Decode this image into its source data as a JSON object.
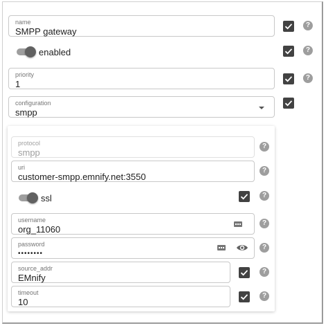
{
  "gateway": {
    "name": {
      "label": "name",
      "value": "SMPP gateway"
    },
    "enabled": {
      "label": "enabled"
    },
    "priority": {
      "label": "priority",
      "value": "1"
    },
    "configuration": {
      "label": "configuration",
      "value": "smpp"
    }
  },
  "smpp": {
    "protocol": {
      "label": "protocol",
      "value": "smpp"
    },
    "uri": {
      "label": "uri",
      "value": "customer-smpp.emnify.net:3550"
    },
    "ssl": {
      "label": "ssl"
    },
    "username": {
      "label": "username",
      "value": "org_11060"
    },
    "password": {
      "label": "password",
      "value": "••••••••"
    },
    "source_addr": {
      "label": "source_addr",
      "value": "EMnify"
    },
    "timeout": {
      "label": "timeout",
      "value": "10"
    }
  },
  "help_glyph": "?",
  "icons": [
    "check-icon",
    "help-icon",
    "chevron-down-icon",
    "keyboard-icon",
    "eye-icon"
  ],
  "colors": {
    "checkbox": "#424242",
    "help": "#9e9e9e",
    "toggle_thumb": "#616161",
    "toggle_track": "#9e9e9e"
  }
}
